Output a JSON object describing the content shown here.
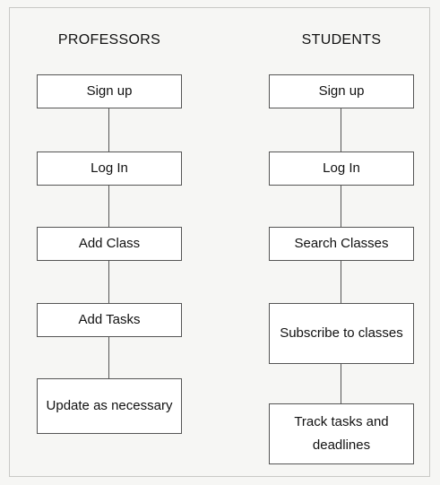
{
  "professors": {
    "heading": "PROFESSORS",
    "steps": [
      "Sign up",
      "Log In",
      "Add Class",
      "Add Tasks",
      "Update as necessary"
    ]
  },
  "students": {
    "heading": "STUDENTS",
    "steps": [
      "Sign up",
      "Log In",
      "Search Classes",
      "Subscribe to classes",
      "Track tasks and deadlines"
    ]
  },
  "colors": {
    "background": "#f6f6f4",
    "box_fill": "#ffffff",
    "box_border": "#555555",
    "text": "#111111"
  }
}
